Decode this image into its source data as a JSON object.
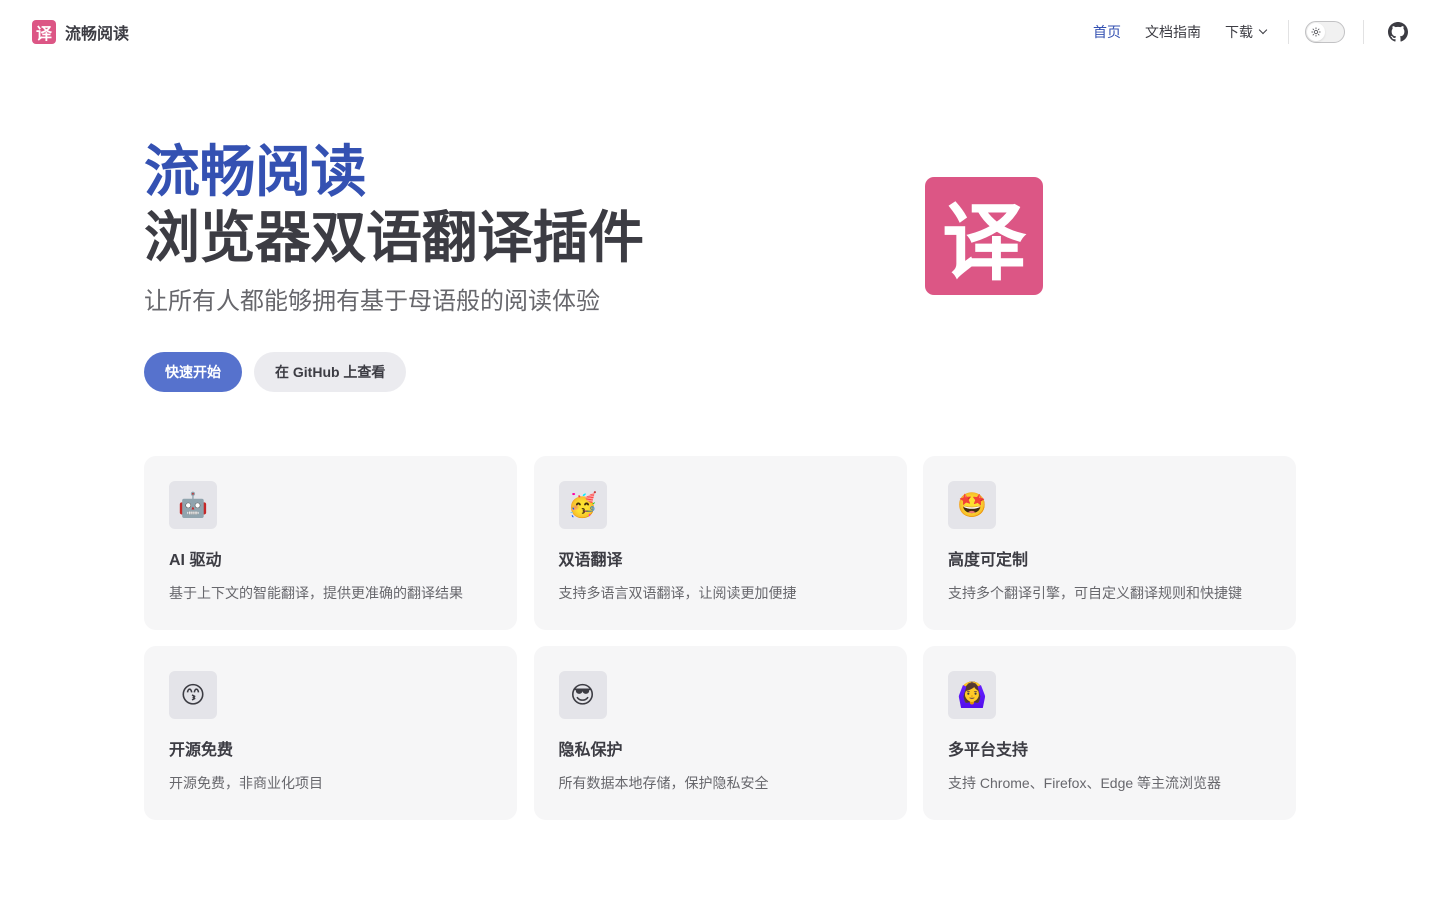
{
  "nav": {
    "logo_glyph": "译",
    "title": "流畅阅读",
    "links": [
      {
        "label": "首页",
        "active": true
      },
      {
        "label": "文档指南",
        "active": false
      },
      {
        "label": "下载",
        "active": false
      }
    ],
    "theme_toggle_icon": "sun-icon",
    "github_icon": "github-icon"
  },
  "hero": {
    "name": "流畅阅读",
    "text": "浏览器双语翻译插件",
    "tagline": "让所有人都能够拥有基于母语般的阅读体验",
    "actions": [
      {
        "label": "快速开始",
        "theme": "brand"
      },
      {
        "label": "在 GitHub 上查看",
        "theme": "alt"
      }
    ],
    "logo_glyph": "译"
  },
  "features": [
    {
      "icon": "🤖",
      "title": "AI 驱动",
      "details": "基于上下文的智能翻译，提供更准确的翻译结果"
    },
    {
      "icon": "🥳",
      "title": "双语翻译",
      "details": "支持多语言双语翻译，让阅读更加便捷"
    },
    {
      "icon": "🤩",
      "title": "高度可定制",
      "details": "支持多个翻译引擎，可自定义翻译规则和快捷键"
    },
    {
      "icon": "😙",
      "title": "开源免费",
      "details": "开源免费，非商业化项目"
    },
    {
      "icon": "😎",
      "title": "隐私保护",
      "details": "所有数据本地存储，保护隐私安全"
    },
    {
      "icon": "🙆‍♀️",
      "title": "多平台支持",
      "details": "支持 Chrome、Firefox、Edge 等主流浏览器"
    }
  ],
  "colors": {
    "brand": "#3451b2",
    "brand_button": "#5672cd",
    "logo_bg": "#dc5685",
    "text": "#3c3c43",
    "muted": "#67676c",
    "card_bg": "#f6f6f7"
  }
}
